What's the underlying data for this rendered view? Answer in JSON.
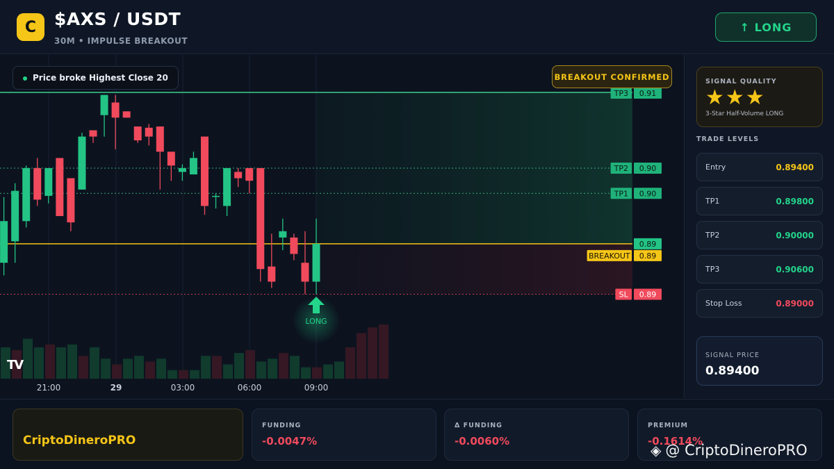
{
  "header": {
    "logo_letter": "C",
    "pair": "$AXS / USDT",
    "subtitle": "30M • IMPULSE BREAKOUT",
    "direction_label": "↑ LONG"
  },
  "chart": {
    "pill_text": "Price broke Highest Close 20",
    "confirm_badge": "BREAKOUT CONFIRMED",
    "tv_logo": "TV",
    "signal_marker_label": "LONG",
    "x_ticks": [
      "21:00",
      "29",
      "03:00",
      "06:00",
      "09:00"
    ],
    "price_tags": {
      "tp3": {
        "name": "TP3",
        "value": "0.91"
      },
      "tp2": {
        "name": "TP2",
        "value": "0.90"
      },
      "tp1": {
        "name": "TP1",
        "value": "0.90"
      },
      "last": {
        "value": "0.89"
      },
      "breakout": {
        "name": "BREAKOUT",
        "value": "0.89"
      },
      "sl": {
        "name": "SL",
        "value": "0.89"
      }
    },
    "colors": {
      "bull": "#23c485",
      "bear": "#f04a5c",
      "breakout_line": "#f5c518",
      "tp_line": "#3ecf8e",
      "sl_line": "#f04a5c"
    }
  },
  "chart_data": {
    "type": "candlestick",
    "interval": "30m",
    "levels": {
      "entry": 0.894,
      "tp1": 0.898,
      "tp2": 0.9,
      "tp3": 0.906,
      "stop_loss": 0.89
    },
    "candles": [
      {
        "o": 0.894,
        "h": 0.8995,
        "l": 0.8925,
        "c": 0.897
      },
      {
        "o": 0.8925,
        "h": 0.8977,
        "l": 0.8915,
        "c": 0.8958
      },
      {
        "o": 0.8942,
        "h": 0.8988,
        "l": 0.8925,
        "c": 0.8982
      },
      {
        "o": 0.8958,
        "h": 0.9002,
        "l": 0.8953,
        "c": 0.9
      },
      {
        "o": 0.9,
        "h": 0.9008,
        "l": 0.897,
        "c": 0.8975
      },
      {
        "o": 0.8978,
        "h": 0.9,
        "l": 0.8972,
        "c": 0.9
      },
      {
        "o": 0.9008,
        "h": 0.9008,
        "l": 0.8962,
        "c": 0.8962
      },
      {
        "o": 0.8992,
        "h": 0.8992,
        "l": 0.895,
        "c": 0.8957
      },
      {
        "o": 0.8983,
        "h": 0.9028,
        "l": 0.8983,
        "c": 0.9025
      },
      {
        "o": 0.903,
        "h": 0.903,
        "l": 0.902,
        "c": 0.9025
      },
      {
        "o": 0.9042,
        "h": 0.9058,
        "l": 0.9025,
        "c": 0.9058
      },
      {
        "o": 0.9052,
        "h": 0.9058,
        "l": 0.9015,
        "c": 0.904
      },
      {
        "o": 0.9045,
        "h": 0.9045,
        "l": 0.904,
        "c": 0.904
      },
      {
        "o": 0.9033,
        "h": 0.9033,
        "l": 0.902,
        "c": 0.9022
      },
      {
        "o": 0.9032,
        "h": 0.9035,
        "l": 0.9018,
        "c": 0.9025
      },
      {
        "o": 0.9033,
        "h": 0.9033,
        "l": 0.8983,
        "c": 0.9013
      },
      {
        "o": 0.9013,
        "h": 0.9013,
        "l": 0.899,
        "c": 0.9002
      },
      {
        "o": 0.8997,
        "h": 0.9003,
        "l": 0.899,
        "c": 0.9
      },
      {
        "o": 0.8995,
        "h": 0.9013,
        "l": 0.8995,
        "c": 0.9008
      },
      {
        "o": 0.9025,
        "h": 0.9025,
        "l": 0.8963,
        "c": 0.897
      },
      {
        "o": 0.8978,
        "h": 0.898,
        "l": 0.8968,
        "c": 0.8978
      },
      {
        "o": 0.897,
        "h": 0.9,
        "l": 0.8962,
        "c": 0.9
      },
      {
        "o": 0.8997,
        "h": 0.9,
        "l": 0.8985,
        "c": 0.8992
      },
      {
        "o": 0.9,
        "h": 0.9,
        "l": 0.898,
        "c": 0.899
      },
      {
        "o": 0.9,
        "h": 0.9,
        "l": 0.891,
        "c": 0.892
      },
      {
        "o": 0.8922,
        "h": 0.8948,
        "l": 0.8905,
        "c": 0.891
      },
      {
        "o": 0.8945,
        "h": 0.896,
        "l": 0.8935,
        "c": 0.895
      },
      {
        "o": 0.8945,
        "h": 0.8948,
        "l": 0.8927,
        "c": 0.8932
      },
      {
        "o": 0.8925,
        "h": 0.895,
        "l": 0.89,
        "c": 0.891
      },
      {
        "o": 0.891,
        "h": 0.896,
        "l": 0.89,
        "c": 0.894
      }
    ],
    "volume": [
      55,
      50,
      70,
      55,
      60,
      55,
      60,
      40,
      55,
      35,
      25,
      35,
      40,
      30,
      35,
      15,
      15,
      15,
      40,
      40,
      25,
      45,
      50,
      30,
      35,
      45,
      40,
      20,
      20,
      25,
      30,
      55,
      80,
      90,
      95
    ]
  },
  "right_panel": {
    "quality_title": "SIGNAL QUALITY",
    "stars": "★★★",
    "quality_desc": "3-Star Half-Volume LONG",
    "trade_levels_title": "TRADE LEVELS",
    "levels": [
      {
        "label": "Entry",
        "value": "0.89400",
        "color": "#f5c518"
      },
      {
        "label": "TP1",
        "value": "0.89800",
        "color": "#23d48a"
      },
      {
        "label": "TP2",
        "value": "0.90000",
        "color": "#23d48a"
      },
      {
        "label": "TP3",
        "value": "0.90600",
        "color": "#23d48a"
      },
      {
        "label": "Stop Loss",
        "value": "0.89000",
        "color": "#f04a5c"
      }
    ],
    "signal_price_title": "SIGNAL PRICE",
    "signal_price": "0.89400"
  },
  "footer": {
    "brand": "CriptoDineroPRO",
    "cards": [
      {
        "title": "FUNDING",
        "value": "-0.0047%"
      },
      {
        "title": "Δ FUNDING",
        "value": "-0.0060%"
      },
      {
        "title": "PREMIUM",
        "value": "-0.1614%"
      }
    ],
    "watermark": "@ CriptoDineroPRO"
  }
}
